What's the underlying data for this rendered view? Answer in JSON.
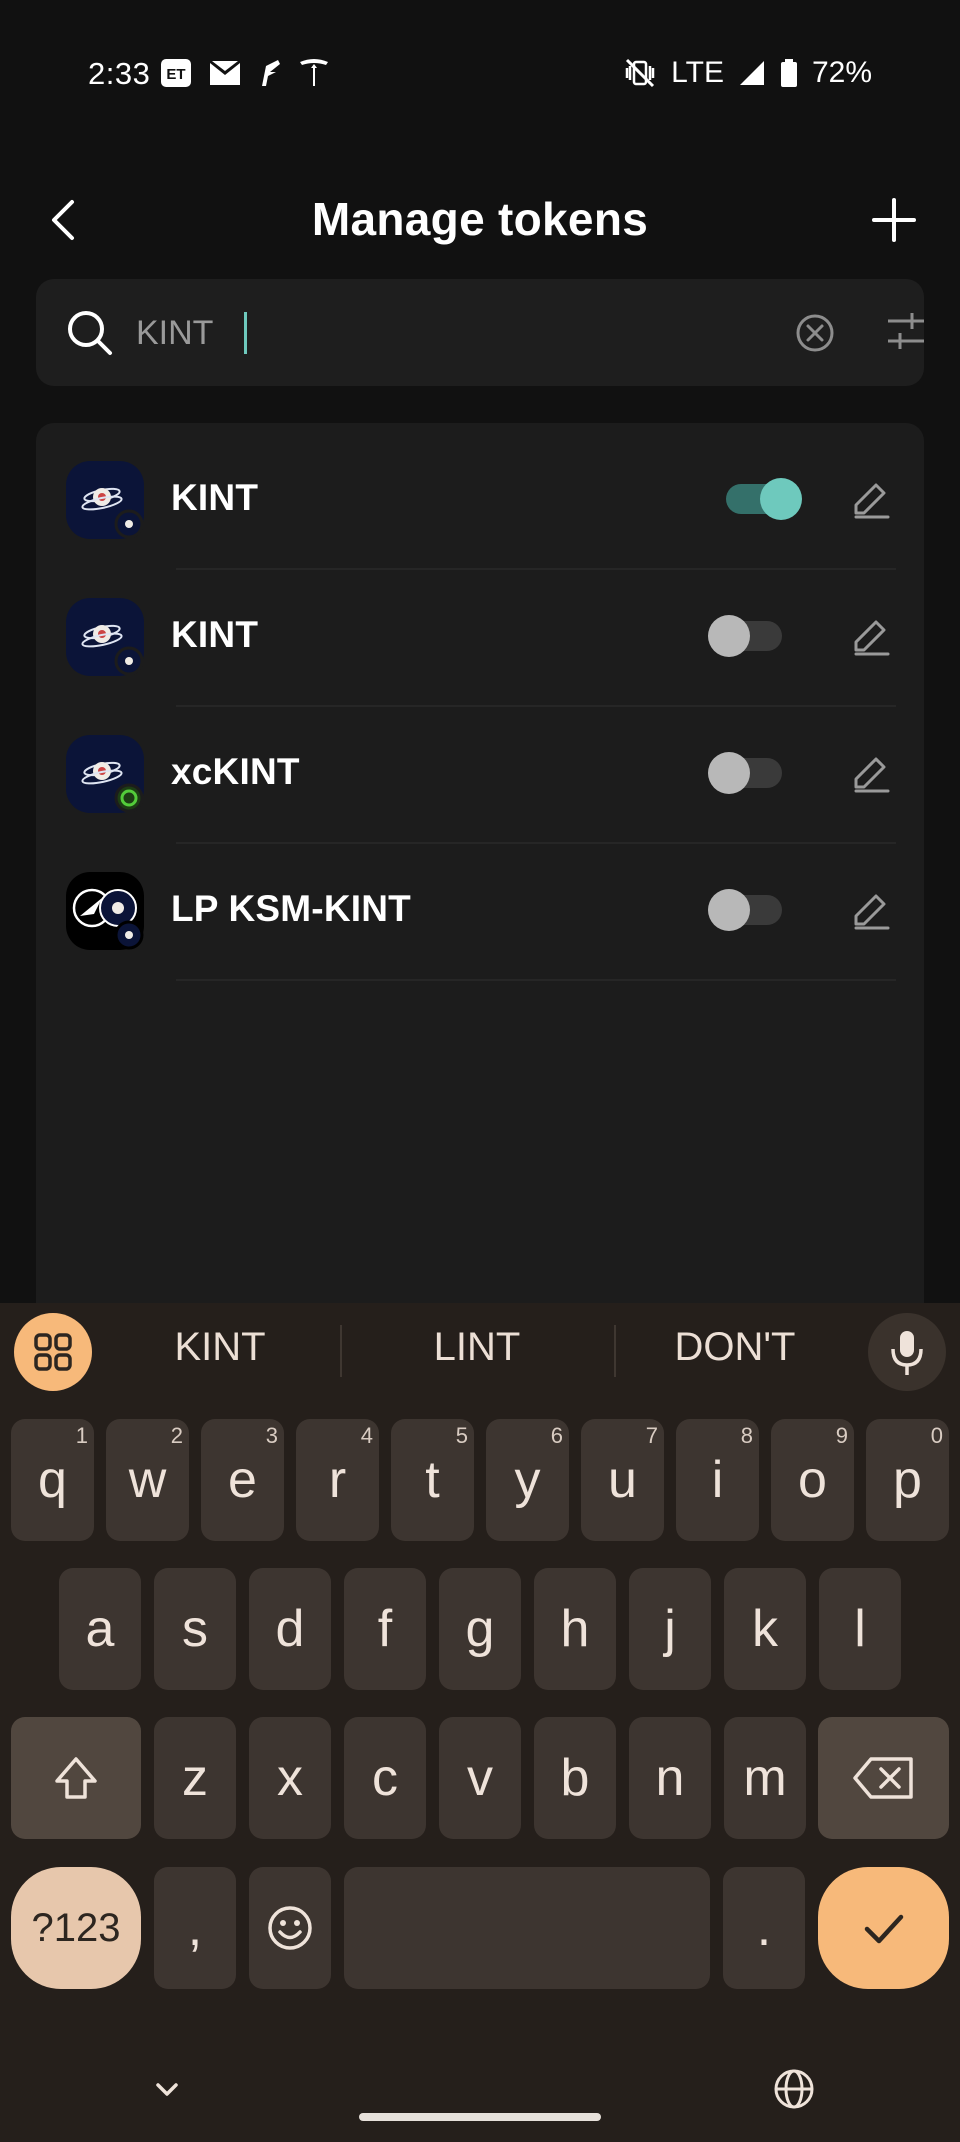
{
  "status_bar": {
    "time": "2:33",
    "icons_left": [
      "et-icon",
      "mail-icon",
      "feather-icon",
      "tesla-icon"
    ],
    "network": "LTE",
    "battery": "72%"
  },
  "header": {
    "title": "Manage tokens"
  },
  "search": {
    "value": "KINT",
    "placeholder": ""
  },
  "tokens": [
    {
      "name": "KINT",
      "enabled": true
    },
    {
      "name": "KINT",
      "enabled": false
    },
    {
      "name": "xcKINT",
      "enabled": false
    },
    {
      "name": "LP KSM-KINT",
      "enabled": false
    }
  ],
  "keyboard": {
    "suggestions": [
      "KINT",
      "LINT",
      "DON'T"
    ],
    "row1": [
      {
        "k": "q",
        "h": "1"
      },
      {
        "k": "w",
        "h": "2"
      },
      {
        "k": "e",
        "h": "3"
      },
      {
        "k": "r",
        "h": "4"
      },
      {
        "k": "t",
        "h": "5"
      },
      {
        "k": "y",
        "h": "6"
      },
      {
        "k": "u",
        "h": "7"
      },
      {
        "k": "i",
        "h": "8"
      },
      {
        "k": "o",
        "h": "9"
      },
      {
        "k": "p",
        "h": "0"
      }
    ],
    "row2": [
      "a",
      "s",
      "d",
      "f",
      "g",
      "h",
      "j",
      "k",
      "l"
    ],
    "row3": [
      "z",
      "x",
      "c",
      "v",
      "b",
      "n",
      "m"
    ],
    "symbols_label": "?123",
    "comma": ",",
    "period": "."
  },
  "colors": {
    "accent": "#6ec9bd",
    "keyboard_accent": "#f7b97a"
  }
}
